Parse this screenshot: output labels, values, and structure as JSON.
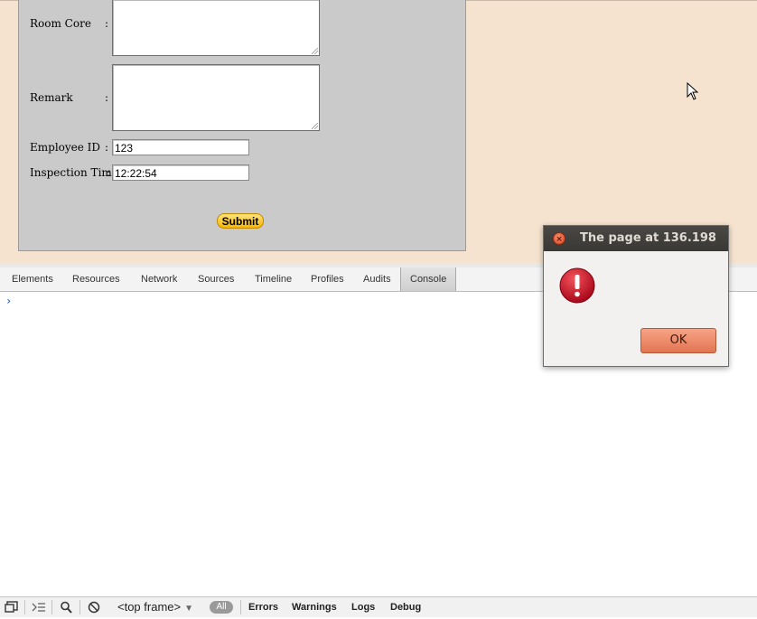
{
  "form": {
    "room_core_label": "Room Core",
    "remark_label": "Remark",
    "employee_id_label": "Employee ID",
    "inspection_time_label": "Inspection Time",
    "colon": ":",
    "employee_id_value": "123",
    "inspection_time_value": "12:22:54",
    "submit_label": "Submit"
  },
  "devtools": {
    "tabs": [
      "Elements",
      "Resources",
      "Network",
      "Sources",
      "Timeline",
      "Profiles",
      "Audits",
      "Console"
    ],
    "active_tab": "Console",
    "prompt_symbol": "›",
    "frame_selector": "<top frame>",
    "filters": {
      "all": "All",
      "errors": "Errors",
      "warnings": "Warnings",
      "logs": "Logs",
      "debug": "Debug"
    }
  },
  "dialog": {
    "title": "The page at 136.198",
    "ok_label": "OK",
    "icon": "error-icon"
  },
  "colors": {
    "page_bg": "#f5e3cf",
    "form_bg": "#cacaca",
    "submit": "#f7b500",
    "ok_button": "#e27552",
    "error_icon": "#c8102e"
  }
}
